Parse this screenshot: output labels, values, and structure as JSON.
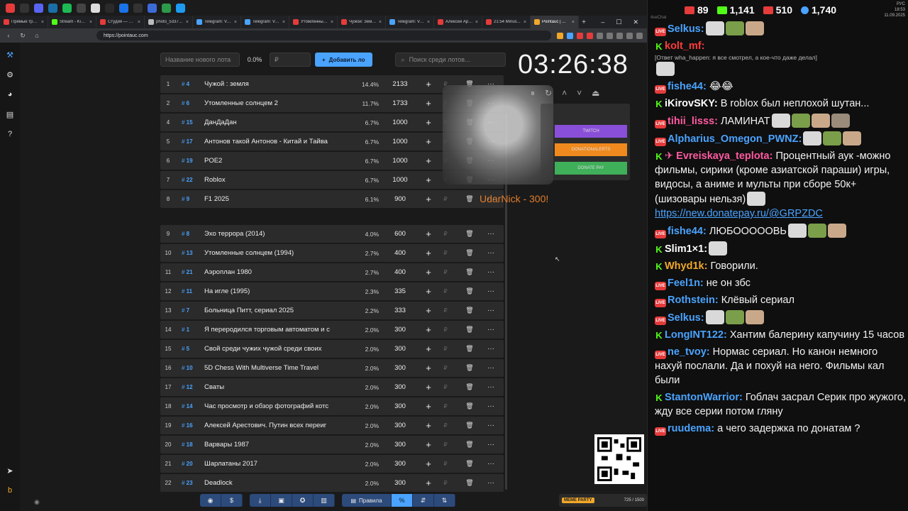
{
  "tabs": [
    {
      "label": "Прямые трансл...",
      "color": "#e53b3b"
    },
    {
      "label": "Stream - Kick D...",
      "color": "#53fc18"
    },
    {
      "label": "Студия — VK В...",
      "color": "#e53b3b"
    },
    {
      "label": "photo_533702...",
      "color": "#bbbbbb"
    },
    {
      "label": "Telegram: View...",
      "color": "#4aa3ff"
    },
    {
      "label": "Telegram: View...",
      "color": "#4aa3ff"
    },
    {
      "label": "Утомленные с...",
      "color": "#e53b3b"
    },
    {
      "label": "Чужой: Земля ...",
      "color": "#e53b3b"
    },
    {
      "label": "Telegram: View...",
      "color": "#4aa3ff"
    },
    {
      "label": "Алексей Арест...",
      "color": "#e53b3b"
    },
    {
      "label": "21:54 Minus...",
      "color": "#e53b3b"
    },
    {
      "label": "Pointauc | ...",
      "color": "#f0a82a",
      "active": true
    }
  ],
  "address": {
    "url": "https://pointauc.com"
  },
  "form": {
    "lot_name_placeholder": "Название нового лота",
    "percent": "0.0%",
    "amount_placeholder": "₽",
    "add_button": "Добавить ло",
    "search_placeholder": "Поиск среди лотов..."
  },
  "timer": "03:26:38",
  "lots_top": [
    {
      "n": "1",
      "id": "4",
      "name": "Чужой : земля",
      "pct": "14.4%",
      "amount": "2133"
    },
    {
      "n": "2",
      "id": "6",
      "name": "Утомленные солнцем 2",
      "pct": "11.7%",
      "amount": "1733"
    },
    {
      "n": "4",
      "id": "15",
      "name": "ДанДаДан",
      "pct": "6.7%",
      "amount": "1000"
    },
    {
      "n": "5",
      "id": "17",
      "name": "Антонов такой Антонов - Китай и Тайва",
      "pct": "6.7%",
      "amount": "1000"
    },
    {
      "n": "6",
      "id": "19",
      "name": "POE2",
      "pct": "6.7%",
      "amount": "1000"
    },
    {
      "n": "7",
      "id": "22",
      "name": "Roblox",
      "pct": "6.7%",
      "amount": "1000"
    },
    {
      "n": "8",
      "id": "9",
      "name": "F1 2025",
      "pct": "6.1%",
      "amount": "900"
    }
  ],
  "lots_bottom": [
    {
      "n": "9",
      "id": "8",
      "name": "Эхо террора (2014)",
      "pct": "4.0%",
      "amount": "600"
    },
    {
      "n": "10",
      "id": "13",
      "name": "Утомленные солнцем (1994)",
      "pct": "2.7%",
      "amount": "400"
    },
    {
      "n": "11",
      "id": "21",
      "name": "Аэроплан 1980",
      "pct": "2.7%",
      "amount": "400"
    },
    {
      "n": "12",
      "id": "11",
      "name": "На игле (1995)",
      "pct": "2.3%",
      "amount": "335"
    },
    {
      "n": "13",
      "id": "7",
      "name": "Больница Питт, сериал 2025",
      "pct": "2.2%",
      "amount": "333"
    },
    {
      "n": "14",
      "id": "1",
      "name": "Я переродился торговым автоматом и с",
      "pct": "2.0%",
      "amount": "300"
    },
    {
      "n": "15",
      "id": "5",
      "name": "Свой среди чужих чужой среди своих",
      "pct": "2.0%",
      "amount": "300"
    },
    {
      "n": "16",
      "id": "10",
      "name": "5D Chess With Multiverse Time Travel",
      "pct": "2.0%",
      "amount": "300"
    },
    {
      "n": "17",
      "id": "12",
      "name": "Сваты",
      "pct": "2.0%",
      "amount": "300"
    },
    {
      "n": "18",
      "id": "14",
      "name": "Час просмотр и обзор фотографий котс",
      "pct": "2.0%",
      "amount": "300"
    },
    {
      "n": "19",
      "id": "16",
      "name": "Алексей Арестович. Путин всех переиг",
      "pct": "2.0%",
      "amount": "300"
    },
    {
      "n": "20",
      "id": "18",
      "name": "Варвары 1987",
      "pct": "2.0%",
      "amount": "300"
    },
    {
      "n": "21",
      "id": "20",
      "name": "Шарлатаны 2017",
      "pct": "2.0%",
      "amount": "300"
    },
    {
      "n": "22",
      "id": "23",
      "name": "Deadlock",
      "pct": "2.0%",
      "amount": "300"
    }
  ],
  "overlay": {
    "twitch": "TWITCH",
    "donationalerts": "DONATIONALERTS",
    "donatepay": "DONATE PAY",
    "donor": "UdarNick - 300!"
  },
  "bottom": {
    "rules": "Правила",
    "percent_symbol": "%"
  },
  "meme": {
    "label": "MEME PARTY",
    "count": "725 / 1500"
  },
  "stats": {
    "youtube": "89",
    "kick": "1,141",
    "vk": "510",
    "total": "1,740"
  },
  "clock": {
    "time": "18:53",
    "date": "11.09.2025",
    "lang": "РУС"
  },
  "chat_title": "4seChat",
  "chat": [
    {
      "plat": "yt",
      "user": "Selkus:",
      "color": "#4aa3ff",
      "text": "",
      "emotes": 3
    },
    {
      "plat": "kick",
      "user": "kolt_mf:",
      "color": "#ff3b3b",
      "text": "",
      "reply": "[Ответ wha_happen: я все смотрел, а кое-что даже делал]",
      "emotes": 1
    },
    {
      "plat": "yt",
      "user": "fishe44:",
      "color": "#4aa3ff",
      "text": "😂😂",
      "emotes": 0
    },
    {
      "plat": "kick",
      "user": "iKirovSKY:",
      "color": "#ffffff",
      "text": "В roblox был неплохой шутан...",
      "emotes": 0
    },
    {
      "plat": "yt",
      "user": "tihii_lisss:",
      "color": "#ff5aa0",
      "text": "ЛАМИНАТ",
      "emotes": 4
    },
    {
      "plat": "yt",
      "user": "Alpharius_Omegon_PWNZ:",
      "color": "#4aa3ff",
      "text": "",
      "emotes": 3
    },
    {
      "plat": "kick",
      "user": "✈ Evreiskaya_teplota:",
      "color": "#ff5aa0",
      "text": "Процентный аук -можно фильмы, сирики (кроме азиатской параши) игры, видосы, а аниме и мульты при сборе 50к+ (шизовары нельзя)",
      "link": "https://new.donatepay.ru/@GRPZDC",
      "emotes": 1
    },
    {
      "plat": "yt",
      "user": "fishe44:",
      "color": "#4aa3ff",
      "text": "ЛЮБОООООВЬ",
      "emotes": 3
    },
    {
      "plat": "kick",
      "user": "Slim1×1:",
      "color": "#ffffff",
      "text": "",
      "emotes": 1
    },
    {
      "plat": "kick",
      "user": "Whyd1k:",
      "color": "#f0a82a",
      "text": "Говорили.",
      "emotes": 0
    },
    {
      "plat": "yt",
      "user": "Feel1n:",
      "color": "#4aa3ff",
      "text": "не он збс",
      "emotes": 0
    },
    {
      "plat": "yt",
      "user": "Rothstein:",
      "color": "#4aa3ff",
      "text": "Клёвый сериал",
      "emotes": 0
    },
    {
      "plat": "yt",
      "user": "Selkus:",
      "color": "#4aa3ff",
      "text": "",
      "emotes": 3
    },
    {
      "plat": "kick",
      "user": "LongINT122:",
      "color": "#4aa3ff",
      "text": "Хантим балерину капучину 15 часов",
      "emotes": 0
    },
    {
      "plat": "yt",
      "user": "ne_tvoy:",
      "color": "#4aa3ff",
      "text": "Нормас сериал. Но канон немного нахуй послали. Да и похуй на него. Фильмы кал были",
      "emotes": 0
    },
    {
      "plat": "kick",
      "user": "StantonWarrior:",
      "color": "#4aa3ff",
      "text": "Гоблач засрал Серик про жужого, жду все серии потом гляну",
      "emotes": 0
    },
    {
      "plat": "yt",
      "user": "ruudema:",
      "color": "#4aa3ff",
      "text": "а чего задержка по донатам ?",
      "emotes": 0
    }
  ]
}
